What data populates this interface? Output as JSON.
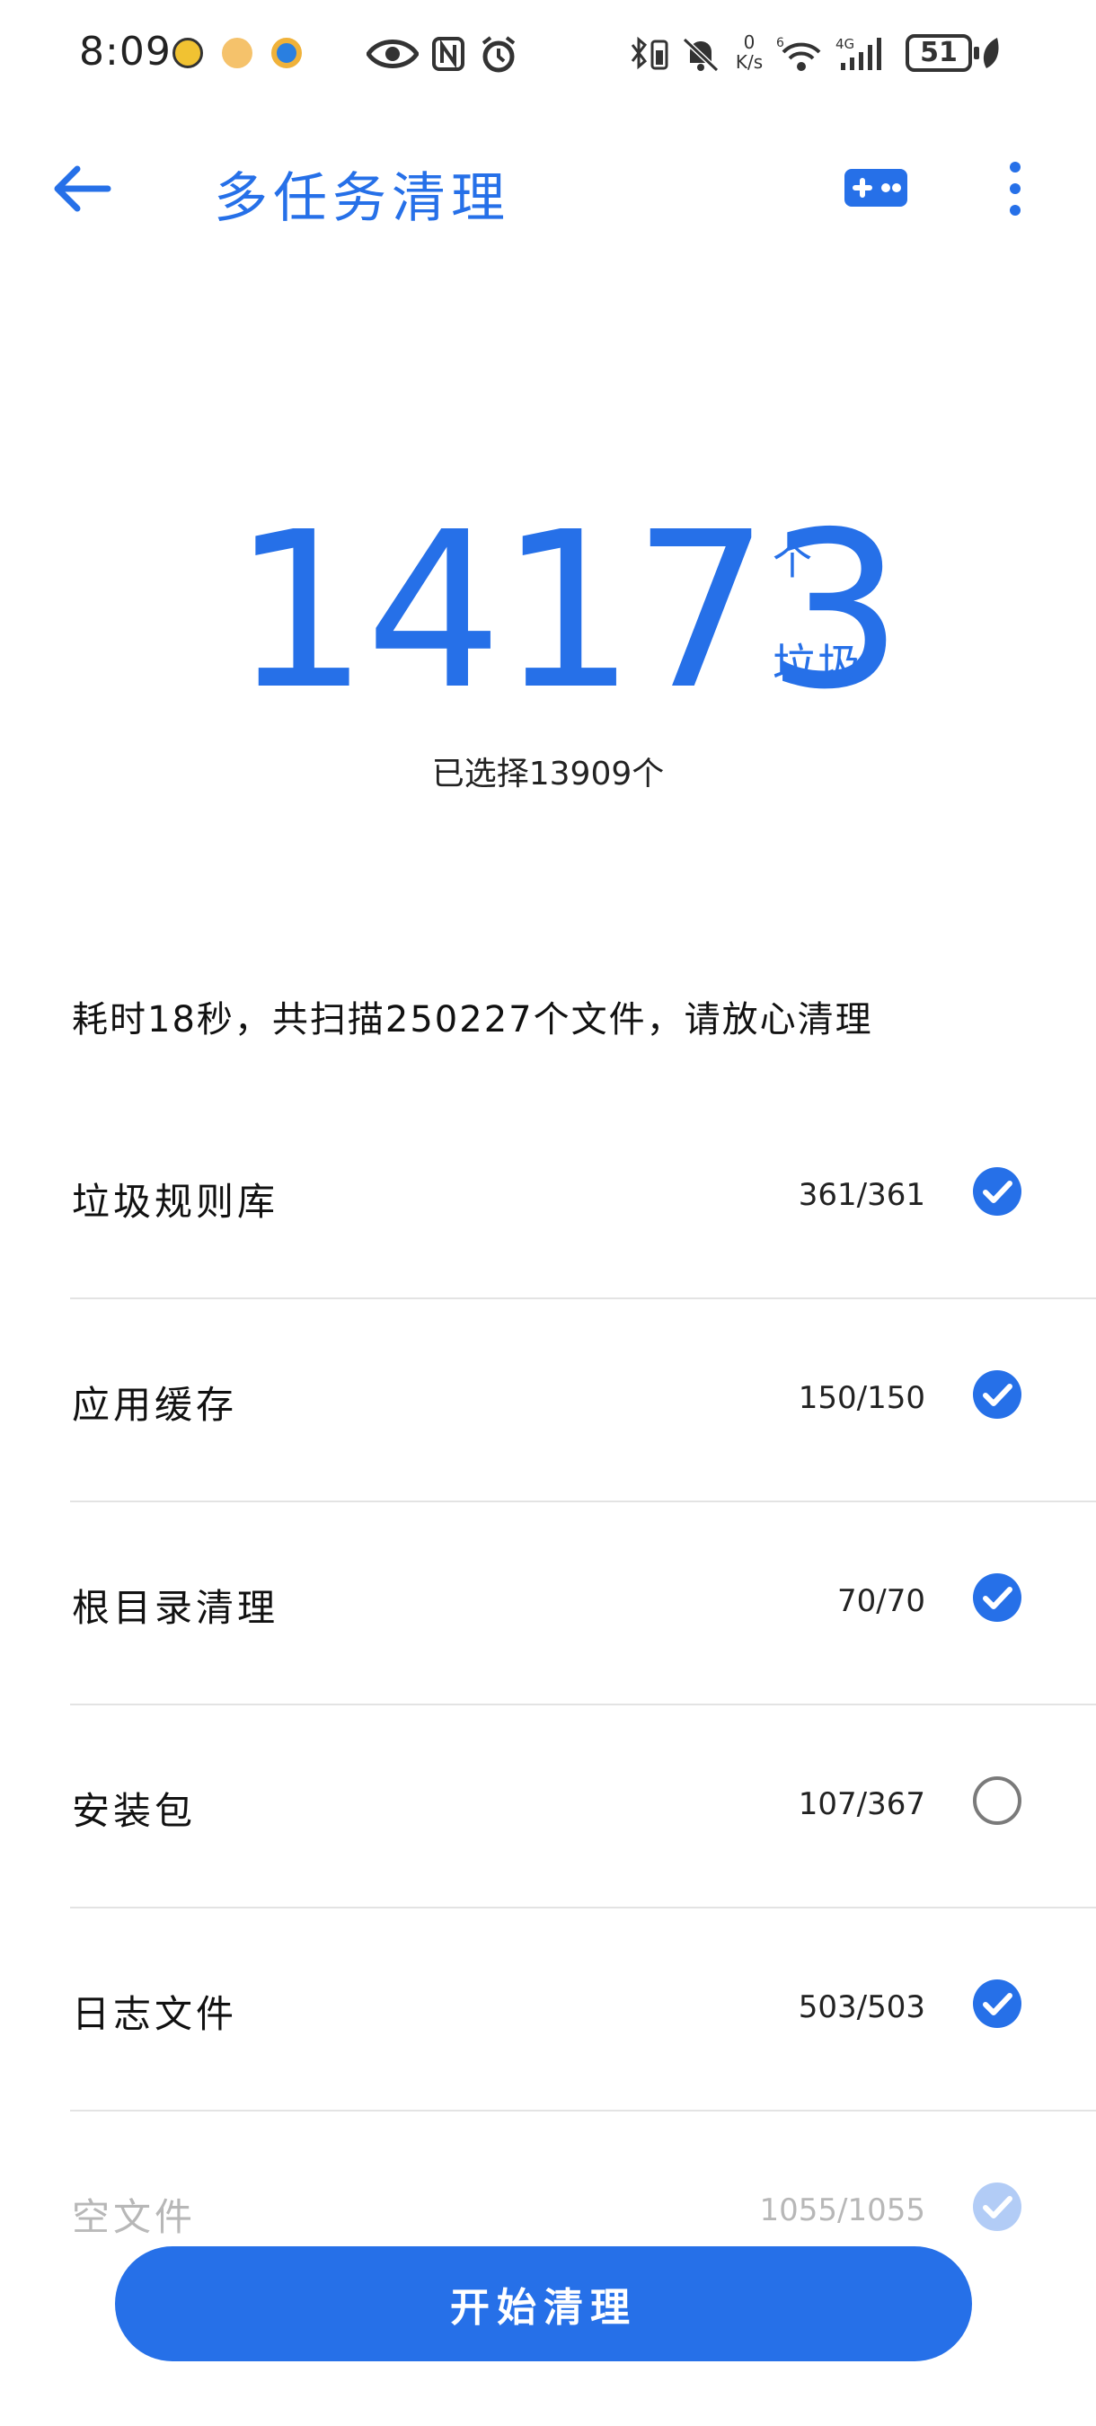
{
  "status_bar": {
    "time": "8:09",
    "net_speed_value": "0",
    "net_speed_unit": "K/s",
    "battery": "51",
    "network": "4G"
  },
  "header": {
    "title": "多任务清理",
    "icons": [
      "back-arrow-icon",
      "gamepad-icon",
      "more-vert-icon"
    ]
  },
  "hero": {
    "count": "14173",
    "unit_top": "个",
    "unit_bottom": "垃圾",
    "selected": "已选择13909个"
  },
  "summary": "耗时18秒，共扫描250227个文件，请放心清理",
  "items": [
    {
      "label": "垃圾规则库",
      "count": "361/361",
      "checked": true
    },
    {
      "label": "应用缓存",
      "count": "150/150",
      "checked": true
    },
    {
      "label": "根目录清理",
      "count": "70/70",
      "checked": true
    },
    {
      "label": "安装包",
      "count": "107/367",
      "checked": false
    },
    {
      "label": "日志文件",
      "count": "503/503",
      "checked": true
    },
    {
      "label": "空文件",
      "count": "1055/1055",
      "checked": true
    }
  ],
  "action": {
    "label": "开始清理"
  },
  "colors": {
    "accent": "#2670e8",
    "divider": "#e3e3e3"
  }
}
